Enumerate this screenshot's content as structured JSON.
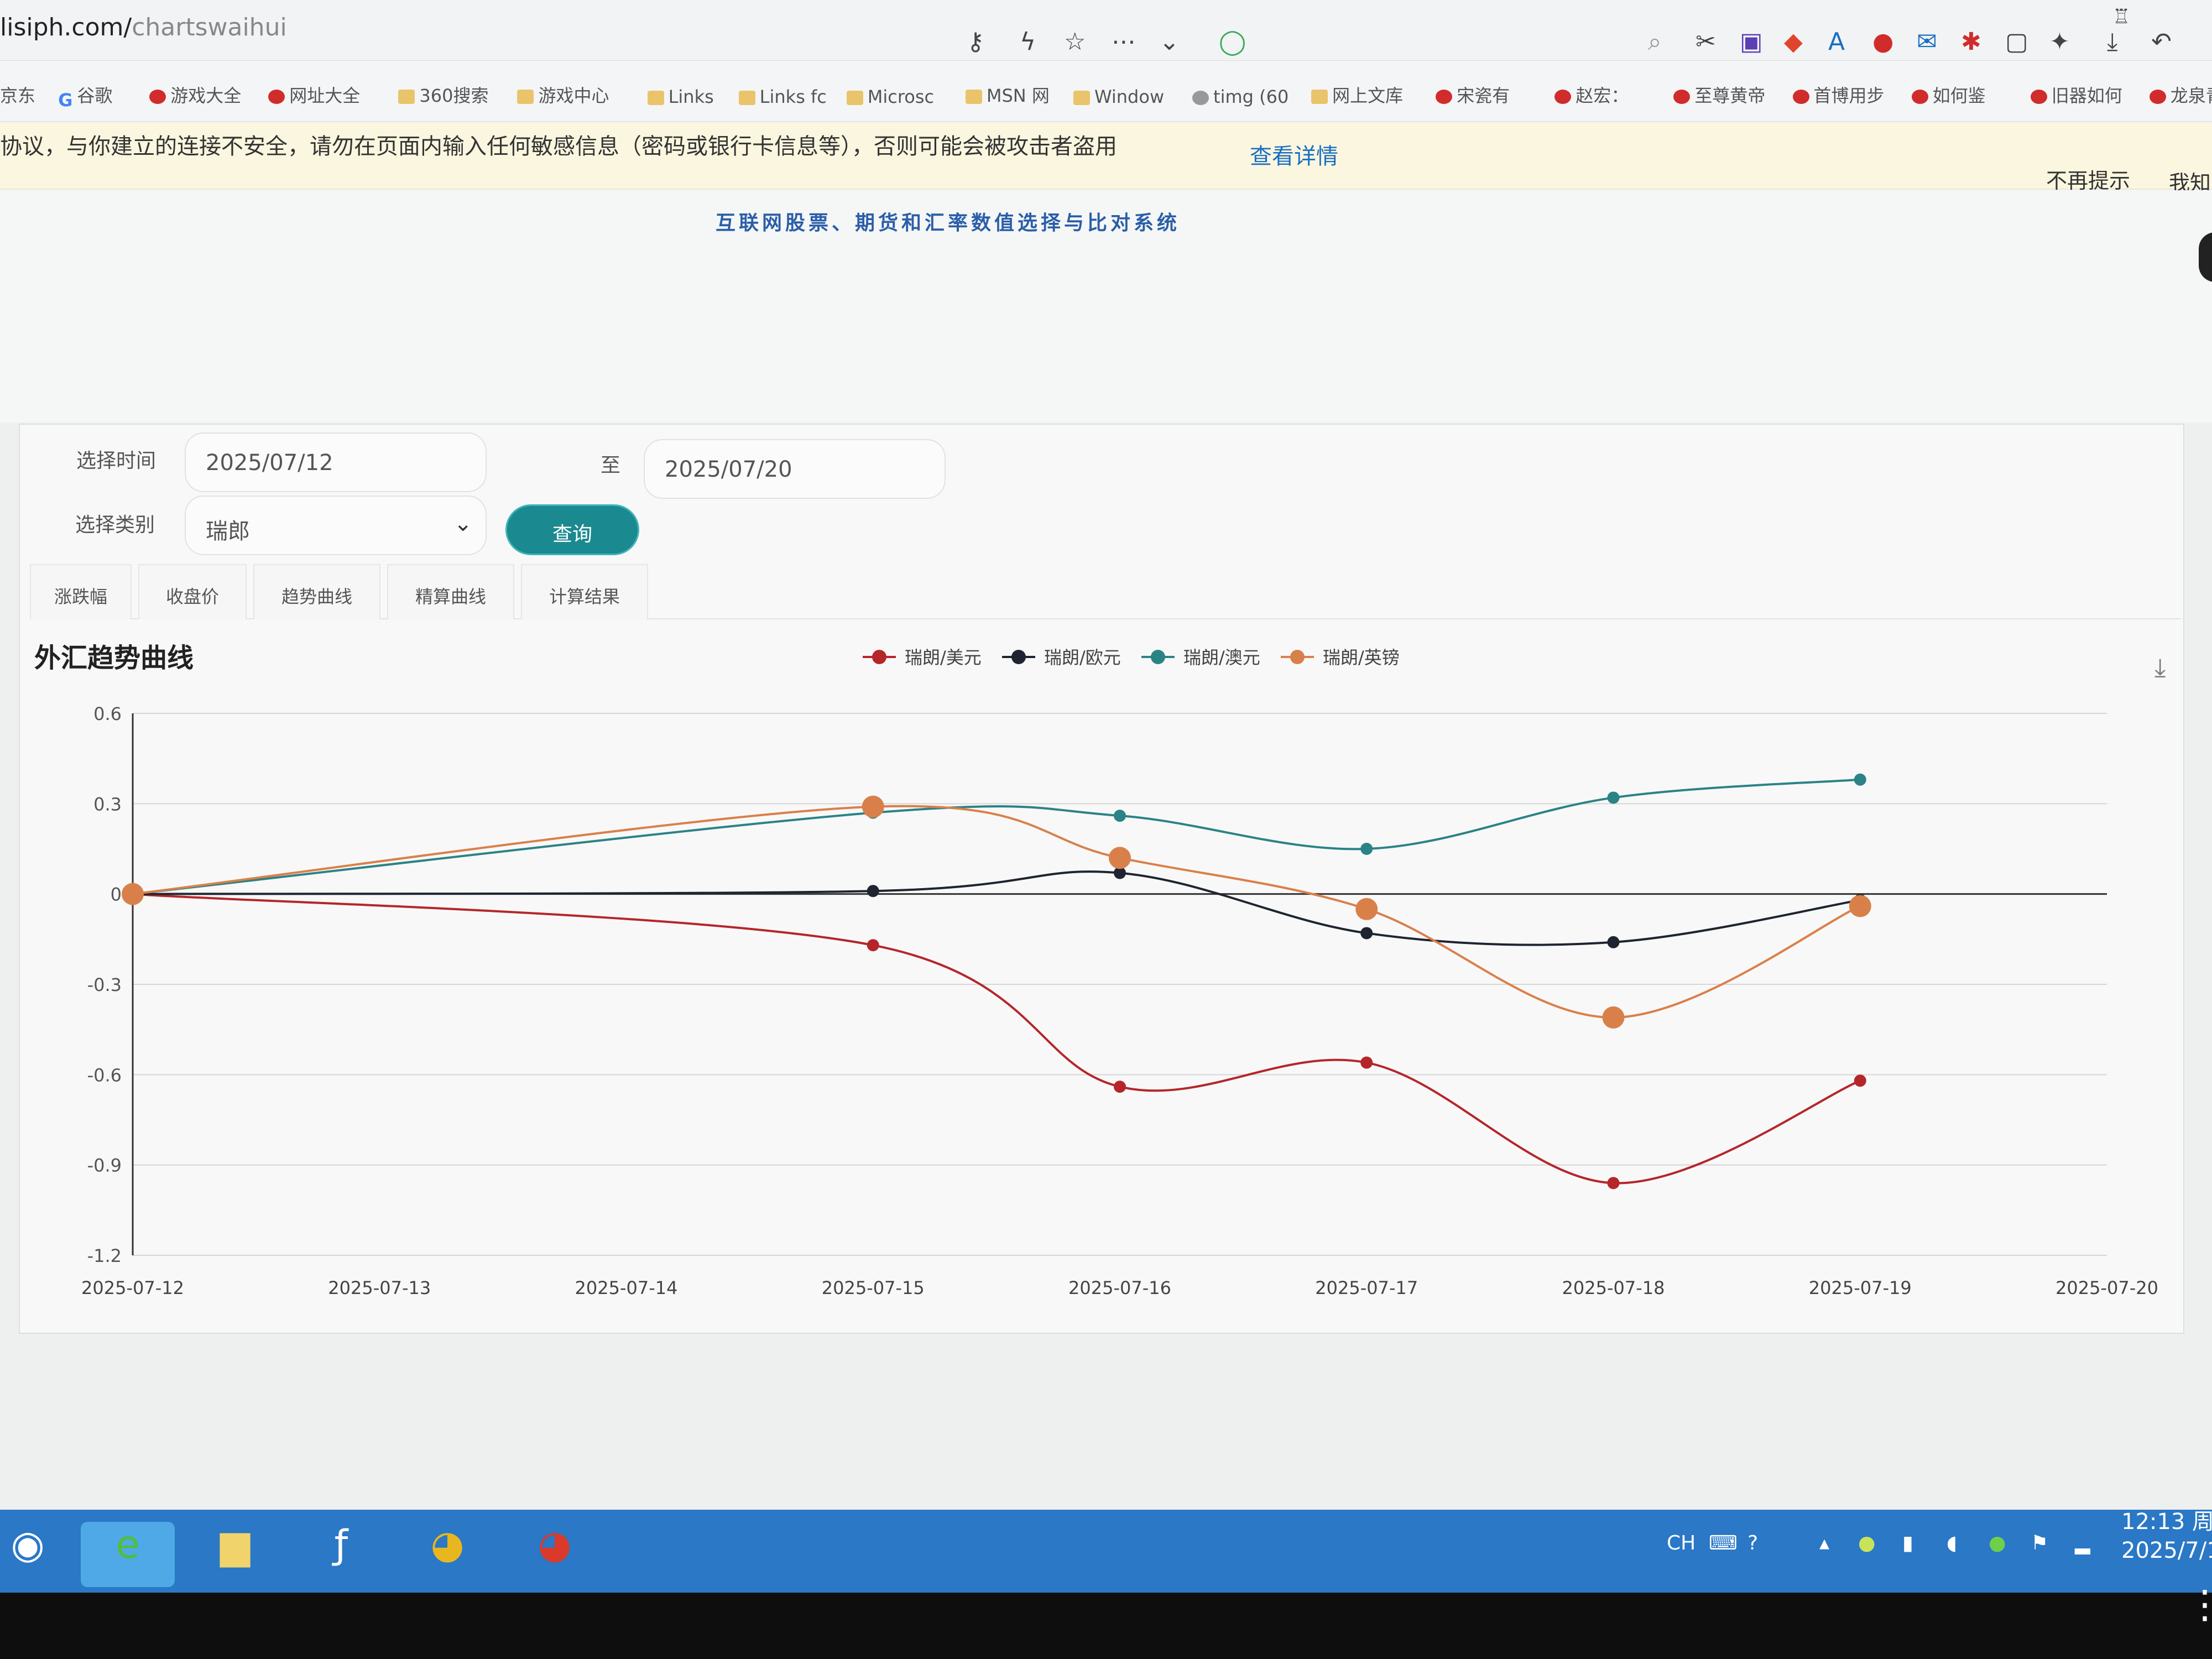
{
  "browser": {
    "url_host": "lisiph.com/",
    "url_path": "chartswaihui",
    "bookmarks": [
      "京东",
      "谷歌",
      "游戏大全",
      "网址大全",
      "360搜索",
      "游戏中心",
      "Links",
      "Links fc",
      "Microsc",
      "MSN 网",
      "Window",
      "timg (60",
      "网上文库",
      "宋瓷有",
      "赵宏：",
      "至尊黄帝",
      "首博用步",
      "如何鉴",
      "旧器如何",
      "龙泉青瓷"
    ],
    "warning": "协议，与你建立的连接不安全，请勿在页面内输入任何敏感信息（密码或银行卡信息等），否则可能会被攻击者盗用",
    "warning_link": "查看详情",
    "no_more": "不再提示",
    "i_know": "我知"
  },
  "page": {
    "system_title": "互联网股票、期货和汇率数值选择与比对系统",
    "time_label": "选择时间",
    "date_from": "2025/07/12",
    "to_label": "至",
    "date_to": "2025/07/20",
    "category_label": "选择类别",
    "category_value": "瑞郎",
    "query_button": "查询",
    "tabs": [
      "涨跌幅",
      "收盘价",
      "趋势曲线",
      "精算曲线",
      "计算结果"
    ]
  },
  "chart_data": {
    "type": "line",
    "title": "外汇趋势曲线",
    "x": [
      "2025-07-12",
      "2025-07-13",
      "2025-07-14",
      "2025-07-15",
      "2025-07-16",
      "2025-07-17",
      "2025-07-18",
      "2025-07-19",
      "2025-07-20"
    ],
    "ylim": [
      -1.2,
      0.6
    ],
    "yticks": [
      "0.6",
      "0.3",
      "0",
      "-0.3",
      "-0.6",
      "-0.9",
      "-1.2"
    ],
    "legend_position": "top-center",
    "series": [
      {
        "name": "瑞朗/美元",
        "color": "#b5262a",
        "points": [
          [
            0,
            0
          ],
          [
            3,
            -0.17
          ],
          [
            4,
            -0.64
          ],
          [
            5,
            -0.56
          ],
          [
            6,
            -0.96
          ],
          [
            7,
            -0.62
          ]
        ]
      },
      {
        "name": "瑞朗/欧元",
        "color": "#1e2530",
        "points": [
          [
            0,
            0
          ],
          [
            3,
            0.01
          ],
          [
            4,
            0.07
          ],
          [
            5,
            -0.13
          ],
          [
            6,
            -0.16
          ],
          [
            7,
            -0.02
          ]
        ]
      },
      {
        "name": "瑞朗/澳元",
        "color": "#2b8386",
        "points": [
          [
            0,
            0
          ],
          [
            3,
            0.27
          ],
          [
            4,
            0.26
          ],
          [
            5,
            0.15
          ],
          [
            6,
            0.32
          ],
          [
            7,
            0.38
          ]
        ]
      },
      {
        "name": "瑞朗/英镑",
        "color": "#d9804a",
        "points": [
          [
            0,
            0
          ],
          [
            3,
            0.29
          ],
          [
            4,
            0.12
          ],
          [
            5,
            -0.05
          ],
          [
            6,
            -0.41
          ],
          [
            7,
            -0.04
          ]
        ]
      }
    ]
  },
  "taskbar": {
    "input_method": "CH",
    "time": "12:13 周",
    "date": "2025/7/1"
  }
}
